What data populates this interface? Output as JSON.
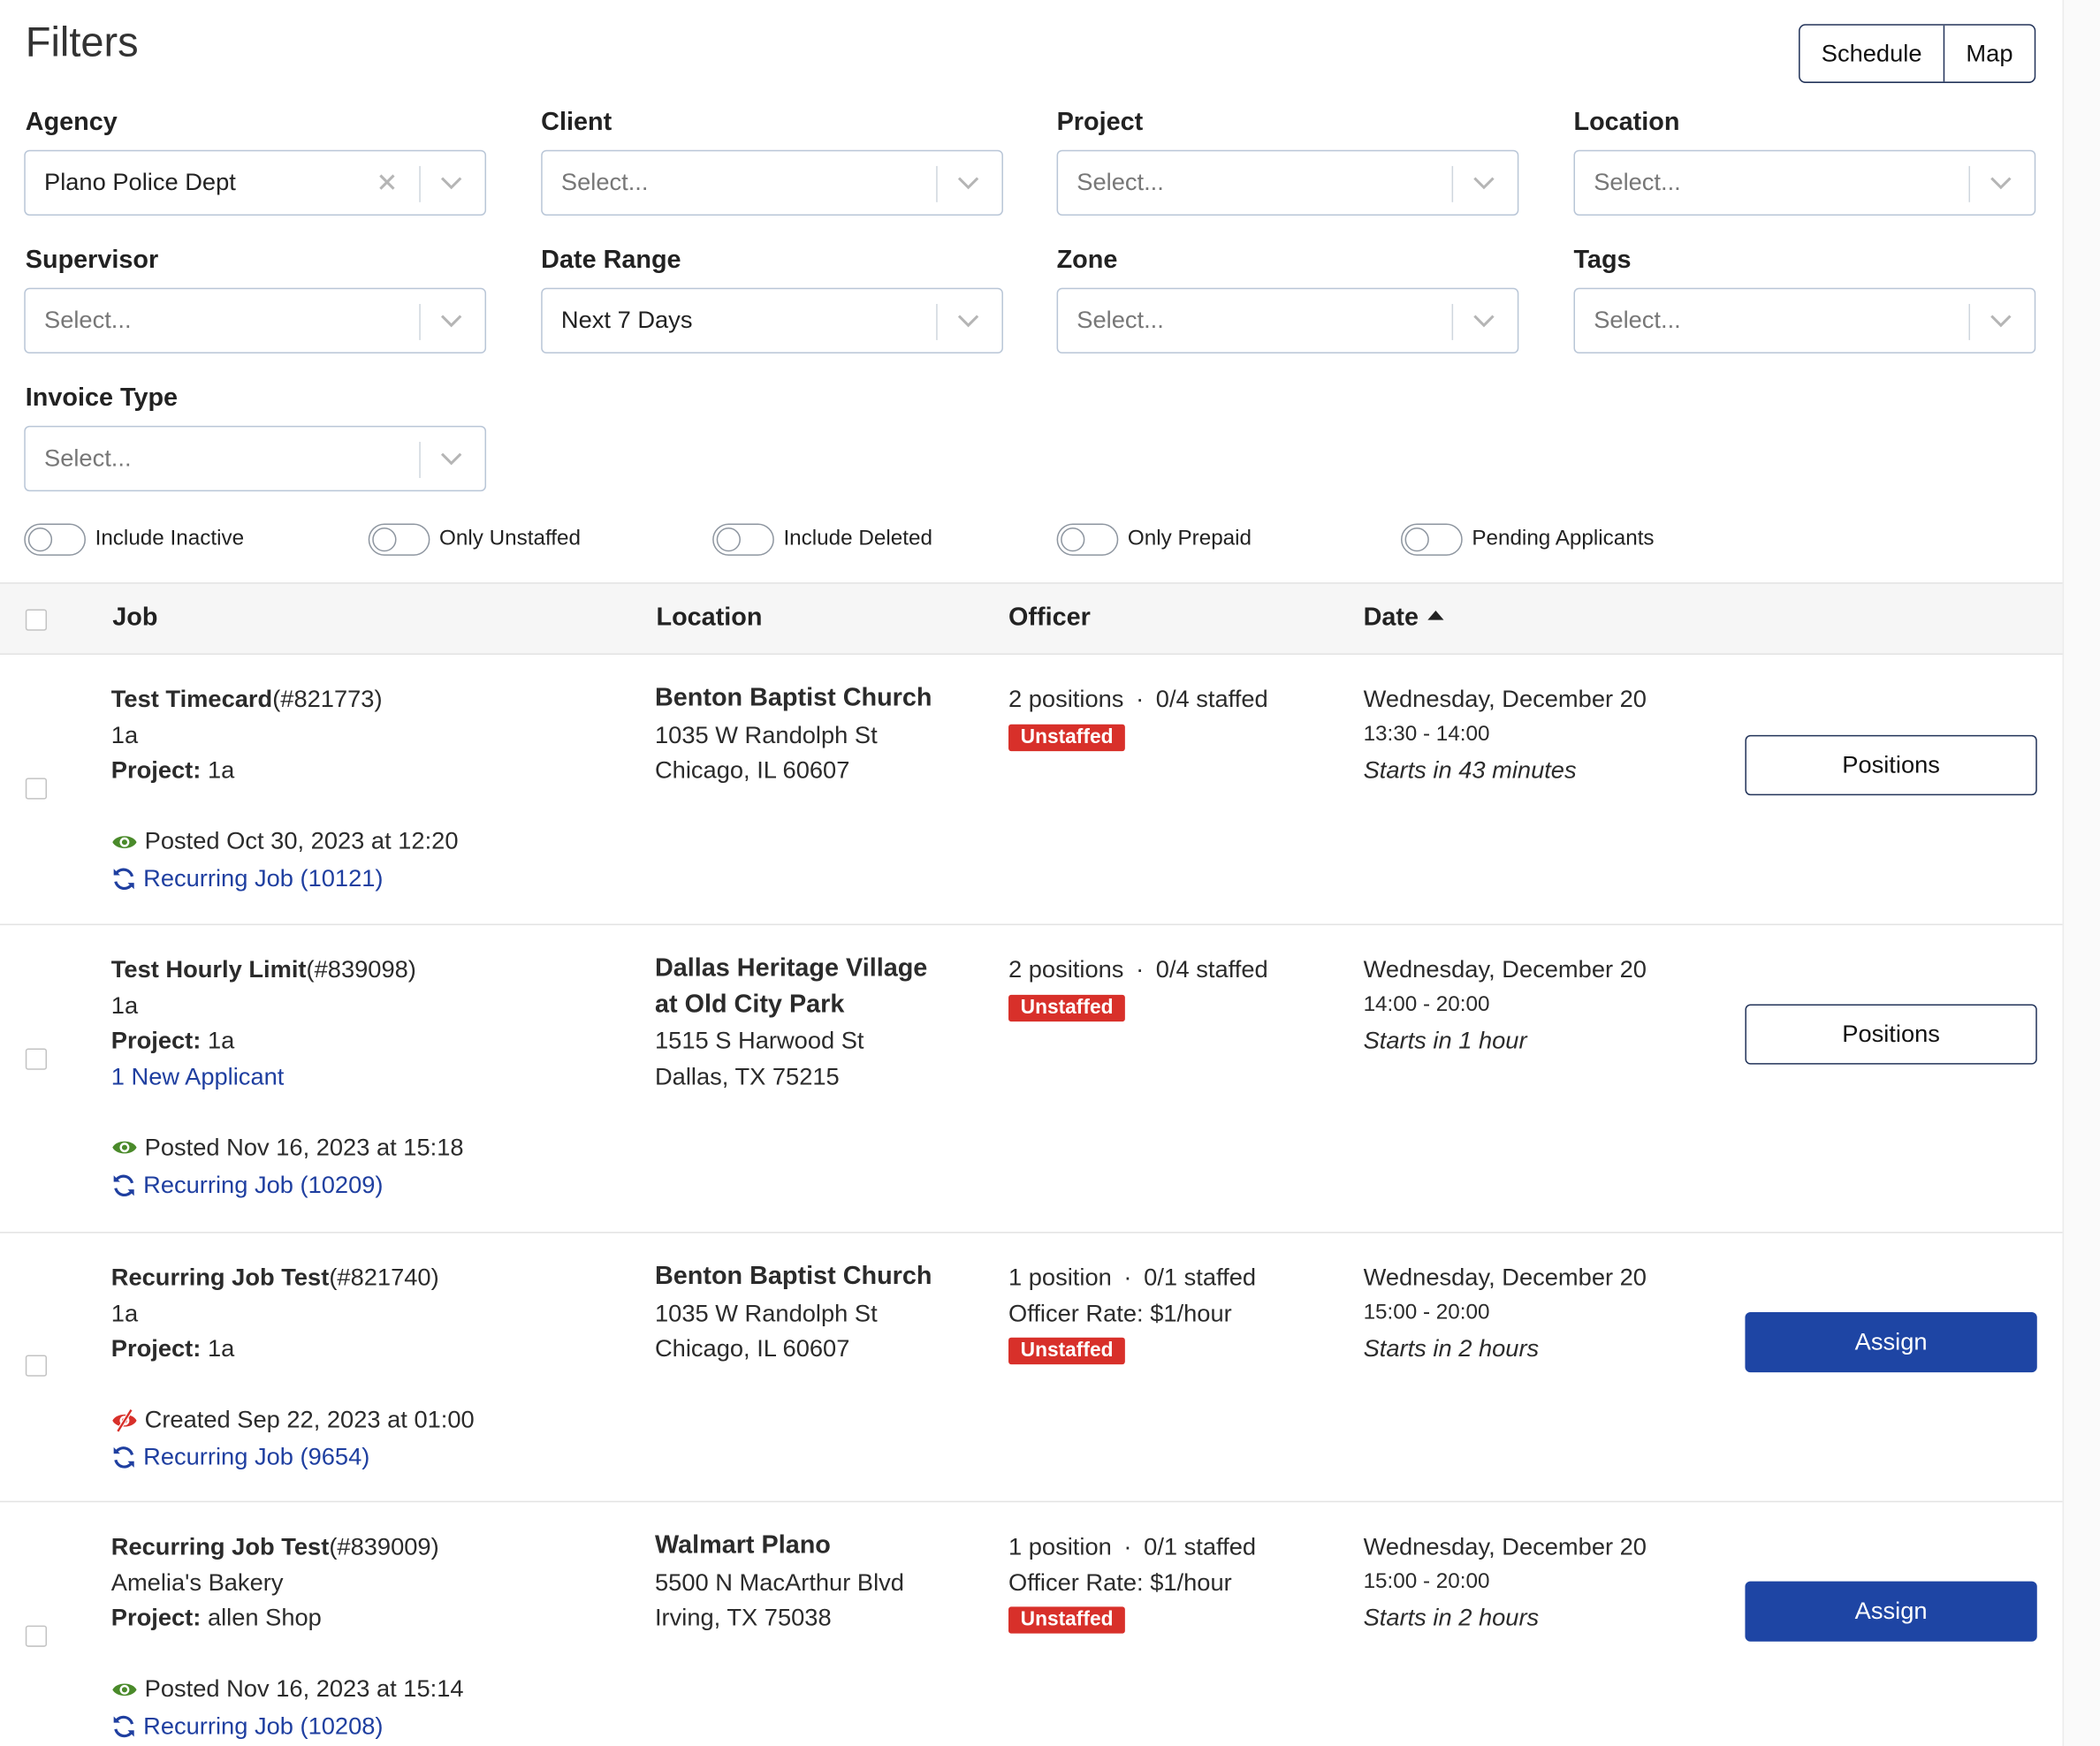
{
  "header": {
    "title": "Filters",
    "view_toggle": {
      "schedule": "Schedule",
      "map": "Map"
    }
  },
  "filters": {
    "agency": {
      "label": "Agency",
      "value": "Plano Police Dept"
    },
    "client": {
      "label": "Client",
      "placeholder": "Select..."
    },
    "project": {
      "label": "Project",
      "placeholder": "Select..."
    },
    "location": {
      "label": "Location",
      "placeholder": "Select..."
    },
    "supervisor": {
      "label": "Supervisor",
      "placeholder": "Select..."
    },
    "date_range": {
      "label": "Date Range",
      "value": "Next 7 Days"
    },
    "zone": {
      "label": "Zone",
      "placeholder": "Select..."
    },
    "tags": {
      "label": "Tags",
      "placeholder": "Select..."
    },
    "invoice_type": {
      "label": "Invoice Type",
      "placeholder": "Select..."
    }
  },
  "toggles": [
    {
      "label": "Include Inactive",
      "on": false
    },
    {
      "label": "Only Unstaffed",
      "on": false
    },
    {
      "label": "Include Deleted",
      "on": false
    },
    {
      "label": "Only Prepaid",
      "on": false
    },
    {
      "label": "Pending Applicants",
      "on": false
    }
  ],
  "table": {
    "columns": {
      "job": "Job",
      "location": "Location",
      "officer": "Officer",
      "date": "Date"
    },
    "sort": {
      "column": "Date",
      "direction": "ascending"
    },
    "rows": [
      {
        "job_title": "Test Timecard",
        "job_number": "(#821773)",
        "client": "1a",
        "project_label": "Project:",
        "project": "1a",
        "status_text": "Posted Oct 30, 2023 at 12:20",
        "status_icon": "eye-icon",
        "recurring": "Recurring Job (10121)",
        "location_name": "Benton Baptist Church",
        "address1": "1035 W Randolph St",
        "address2": "Chicago, IL 60607",
        "positions": "2 positions",
        "separator": "·",
        "staffed": "0/4 staffed",
        "badge": "Unstaffed",
        "date": "Wednesday, December 20",
        "time": "13:30 - 14:00",
        "starts": "Starts in 43 minutes",
        "action": "Positions"
      },
      {
        "job_title": "Test Hourly Limit",
        "job_number": "(#839098)",
        "client": "1a",
        "project_label": "Project:",
        "project": "1a",
        "applicants": "1 New Applicant",
        "status_text": "Posted Nov 16, 2023 at 15:18",
        "status_icon": "eye-icon",
        "recurring": "Recurring Job (10209)",
        "location_name_line1": "Dallas Heritage Village",
        "location_name_line2": "at Old City Park",
        "address1": "1515 S Harwood St",
        "address2": "Dallas, TX 75215",
        "positions": "2 positions",
        "separator": "·",
        "staffed": "0/4 staffed",
        "badge": "Unstaffed",
        "date": "Wednesday, December 20",
        "time": "14:00 - 20:00",
        "starts": "Starts in 1 hour",
        "action": "Positions"
      },
      {
        "job_title": "Recurring Job Test",
        "job_number": "(#821740)",
        "client": "1a",
        "project_label": "Project:",
        "project": "1a",
        "status_text": "Created Sep 22, 2023 at 01:00",
        "status_icon": "eye-slash-icon",
        "recurring": "Recurring Job (9654)",
        "location_name": "Benton Baptist Church",
        "address1": "1035 W Randolph St",
        "address2": "Chicago, IL 60607",
        "positions": "1 position",
        "separator": "·",
        "staffed": "0/1 staffed",
        "officer_rate": "Officer Rate: $1/hour",
        "badge": "Unstaffed",
        "date": "Wednesday, December 20",
        "time": "15:00 - 20:00",
        "starts": "Starts in 2 hours",
        "action": "Assign"
      },
      {
        "job_title": "Recurring Job Test",
        "job_number": "(#839009)",
        "client": "Amelia's Bakery",
        "project_label": "Project:",
        "project": "allen Shop",
        "status_text": "Posted Nov 16, 2023 at 15:14",
        "status_icon": "eye-icon",
        "recurring": "Recurring Job (10208)",
        "location_name": "Walmart Plano",
        "address1": "5500 N MacArthur Blvd",
        "address2": "Irving, TX 75038",
        "positions": "1 position",
        "separator": "·",
        "staffed": "0/1 staffed",
        "officer_rate": "Officer Rate: $1/hour",
        "badge": "Unstaffed",
        "date": "Wednesday, December 20",
        "time": "15:00 - 20:00",
        "starts": "Starts in 2 hours",
        "action": "Assign"
      }
    ]
  },
  "colors": {
    "primary": "#1e45a4",
    "link": "#1f3fa0",
    "unstaffed": "#d8302a",
    "posted_eye": "#4a8a2a",
    "created_eye": "#d8302a"
  }
}
